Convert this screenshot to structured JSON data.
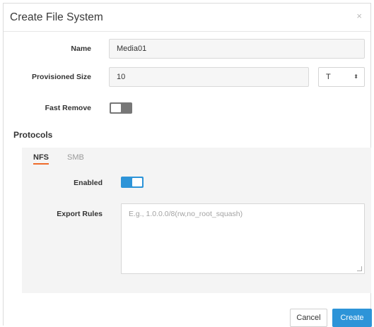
{
  "dialog": {
    "title": "Create File System",
    "close_glyph": "×"
  },
  "form": {
    "name_label": "Name",
    "name_value": "Media01",
    "size_label": "Provisioned Size",
    "size_value": "10",
    "unit_value": "T",
    "unit_arrow_glyph": "⬍",
    "fast_remove_label": "Fast Remove",
    "fast_remove_on": false
  },
  "protocols": {
    "title": "Protocols",
    "tabs": [
      {
        "label": "NFS",
        "active": true
      },
      {
        "label": "SMB",
        "active": false
      }
    ],
    "nfs": {
      "enabled_label": "Enabled",
      "enabled_on": true,
      "export_rules_label": "Export Rules",
      "export_rules_placeholder": "E.g., 1.0.0.0/8(rw,no_root_squash)"
    }
  },
  "footer": {
    "cancel_label": "Cancel",
    "create_label": "Create"
  },
  "colors": {
    "accent": "#2d94d8",
    "tab_underline": "#ee6b2a",
    "toggle_off": "#777777"
  }
}
